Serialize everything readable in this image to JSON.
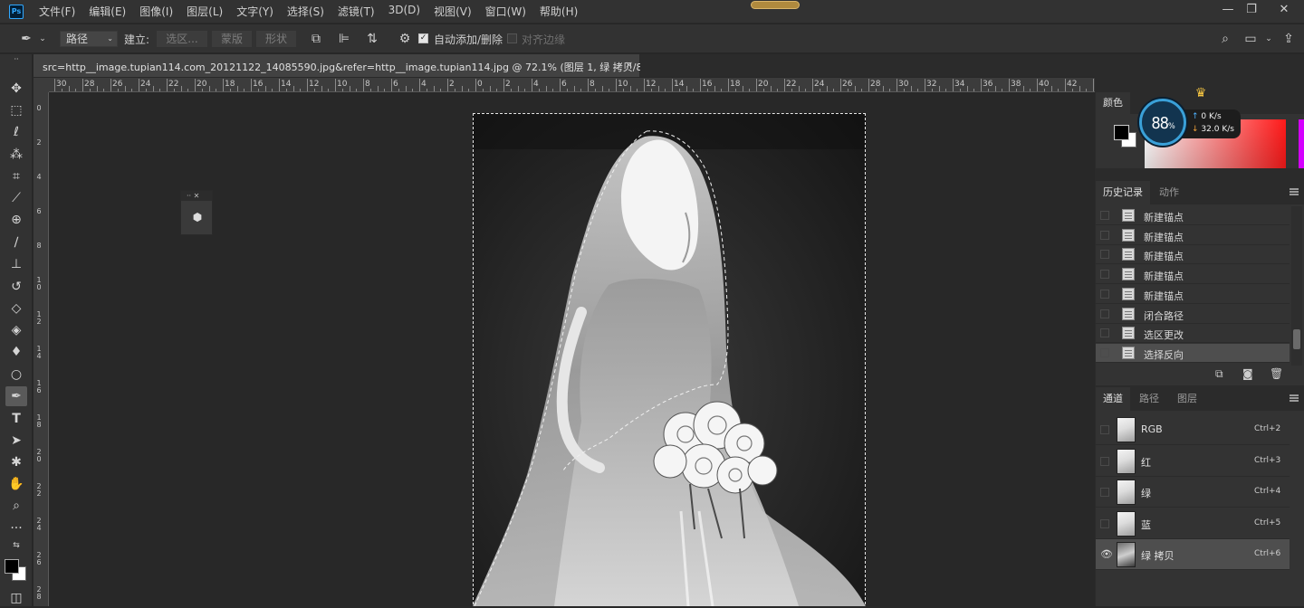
{
  "app": {
    "logo": "Ps",
    "menus": [
      "文件(F)",
      "编辑(E)",
      "图像(I)",
      "图层(L)",
      "文字(Y)",
      "选择(S)",
      "滤镜(T)",
      "3D(D)",
      "视图(V)",
      "窗口(W)",
      "帮助(H)"
    ]
  },
  "options": {
    "mode_value": "路径",
    "make_label": "建立:",
    "selection_btn": "选区...",
    "mask_btn": "蒙版",
    "shape_btn": "形状",
    "auto_add_label": "自动添加/删除",
    "auto_add_checked": true,
    "align_edges_label": "对齐边缘",
    "align_edges_checked": false
  },
  "document": {
    "tab_title": "src=http__image.tupian114.com_20121122_14085590.jpg&refer=http__image.tupian114.jpg  @  72.1% (图层 1, 绿 拷贝/8) *",
    "close_glyph": "×"
  },
  "ruler": {
    "h_labels": [
      "30",
      "28",
      "26",
      "24",
      "22",
      "20",
      "18",
      "16",
      "14",
      "12",
      "10",
      "8",
      "6",
      "4",
      "2",
      "0",
      "2",
      "4",
      "6",
      "8",
      "10",
      "12",
      "14",
      "16",
      "18",
      "20",
      "22",
      "24",
      "26",
      "28",
      "30",
      "32",
      "34",
      "36",
      "38",
      "40",
      "42",
      "44"
    ],
    "v_labels": [
      "0",
      "2",
      "4",
      "6",
      "8",
      "1 0",
      "1 2",
      "1 4",
      "1 6",
      "1 8",
      "2 0",
      "2 2",
      "2 4",
      "2 6",
      "2 8"
    ]
  },
  "speed_widget": {
    "percent": "88",
    "pct_sign": "%",
    "upload": "0 K/s",
    "download": "32.0 K/s"
  },
  "color_panel": {
    "title": "颜色"
  },
  "history_panel": {
    "tabs": [
      "历史记录",
      "动作"
    ],
    "items": [
      {
        "label": "新建锚点",
        "active": false
      },
      {
        "label": "新建锚点",
        "active": false
      },
      {
        "label": "新建锚点",
        "active": false
      },
      {
        "label": "新建锚点",
        "active": false
      },
      {
        "label": "新建锚点",
        "active": false
      },
      {
        "label": "闭合路径",
        "active": false
      },
      {
        "label": "选区更改",
        "active": false
      },
      {
        "label": "选择反向",
        "active": true
      }
    ]
  },
  "channels_panel": {
    "tabs": [
      "通道",
      "路径",
      "图层"
    ],
    "items": [
      {
        "label": "RGB",
        "shortcut": "Ctrl+2",
        "visible": false,
        "active": false
      },
      {
        "label": "红",
        "shortcut": "Ctrl+3",
        "visible": false,
        "active": false
      },
      {
        "label": "绿",
        "shortcut": "Ctrl+4",
        "visible": false,
        "active": false
      },
      {
        "label": "蓝",
        "shortcut": "Ctrl+5",
        "visible": false,
        "active": false
      },
      {
        "label": "绿 拷贝",
        "shortcut": "Ctrl+6",
        "visible": true,
        "active": true
      }
    ]
  },
  "colors": {
    "accent": "#31a8ff",
    "panel_bg": "#333333",
    "canvas_bg": "#282828",
    "hue_red": "#ff1a1a"
  }
}
